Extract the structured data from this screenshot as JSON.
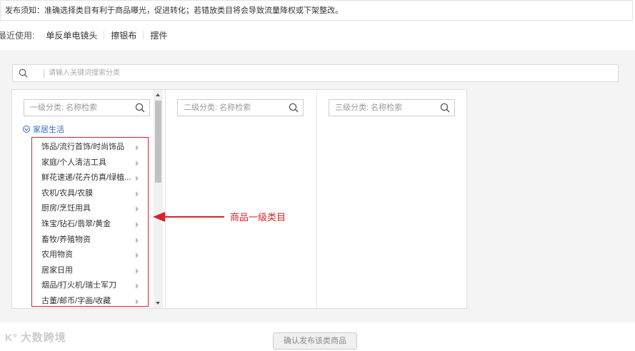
{
  "notice": {
    "text": "发布须知：准确选择类目有利于商品曝光，促进转化；若错放类目将会导致流量降权或下架整改。"
  },
  "recent": {
    "label": "最近使用:",
    "items": [
      "单反单电镜头",
      "擦银布",
      "摆件"
    ]
  },
  "search": {
    "placeholder": "请输入关键词搜索分类",
    "icon": "search-icon"
  },
  "columns": [
    {
      "placeholder": "一级分类: 名称检索"
    },
    {
      "placeholder": "二级分类: 名称检索"
    },
    {
      "placeholder": "三级分类: 名称检索"
    }
  ],
  "tree": {
    "root": "家居生活",
    "items": [
      "饰品/流行首饰/时尚饰品",
      "家庭/个人清洁工具",
      "鲜花速递/花卉仿真/绿植...",
      "农机/农具/农膜",
      "厨房/烹饪用具",
      "珠宝/钻石/翡翠/黄金",
      "畜牧/养殖物资",
      "农用物资",
      "居家日用",
      "烟品/打火机/瑞士军刀",
      "古董/邮币/字画/收藏"
    ]
  },
  "annotation": {
    "text": "商品一级类目",
    "color": "#d9222a"
  },
  "confirm_label": "确认发布该类商品",
  "watermark": {
    "logo": "K°",
    "text": "大数跨境"
  }
}
